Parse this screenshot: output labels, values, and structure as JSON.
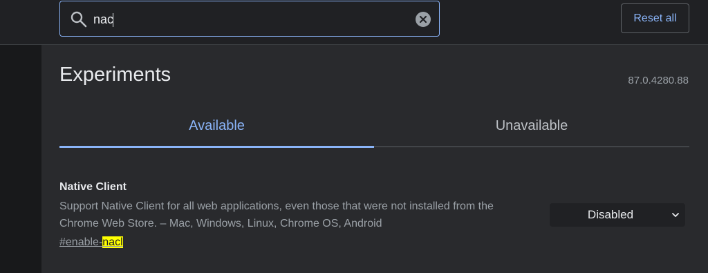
{
  "search": {
    "query": "nac",
    "icon": "search-icon",
    "clear_icon": "clear-icon"
  },
  "reset_label": "Reset all",
  "title": "Experiments",
  "version": "87.0.4280.88",
  "tabs": [
    {
      "label": "Available",
      "selected": true
    },
    {
      "label": "Unavailable",
      "selected": false
    }
  ],
  "experiment": {
    "name": "Native Client",
    "description": "Support Native Client for all web applications, even those that were not installed from the Chrome Web Store. – Mac, Windows, Linux, Chrome OS, Android",
    "link_prefix": "#enable-",
    "link_match": "nacl",
    "status": "Disabled"
  },
  "colors": {
    "accent": "#8ab4f8",
    "highlight": "#ffff00",
    "background": "#202124",
    "panel": "#292a2d"
  }
}
